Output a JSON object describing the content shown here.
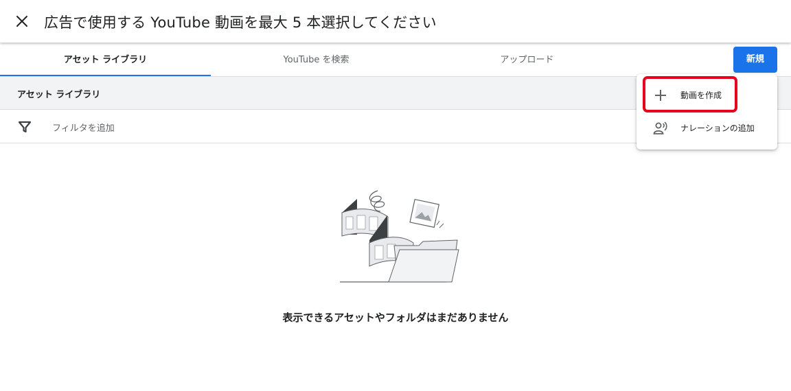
{
  "header": {
    "close_icon": "close-icon",
    "title": "広告で使用する YouTube 動画を最大 5 本選択してください"
  },
  "tabs": [
    {
      "label": "アセット ライブラリ",
      "active": true
    },
    {
      "label": "YouTube を検索",
      "active": false
    },
    {
      "label": "アップロード",
      "active": false
    }
  ],
  "new_button": {
    "label": "新規"
  },
  "section": {
    "title": "アセット ライブラリ"
  },
  "filter": {
    "icon": "filter-icon",
    "placeholder": "フィルタを追加"
  },
  "empty_state": {
    "message": "表示できるアセットやフォルダはまだありません"
  },
  "dropdown": {
    "items": [
      {
        "icon": "plus-icon",
        "label": "動画を作成",
        "highlighted": true
      },
      {
        "icon": "voiceover-icon",
        "label": "ナレーションの追加",
        "highlighted": false
      }
    ]
  },
  "colors": {
    "accent": "#1a73e8",
    "highlight_border": "#e8001c",
    "section_bg": "#f1f3f4"
  }
}
